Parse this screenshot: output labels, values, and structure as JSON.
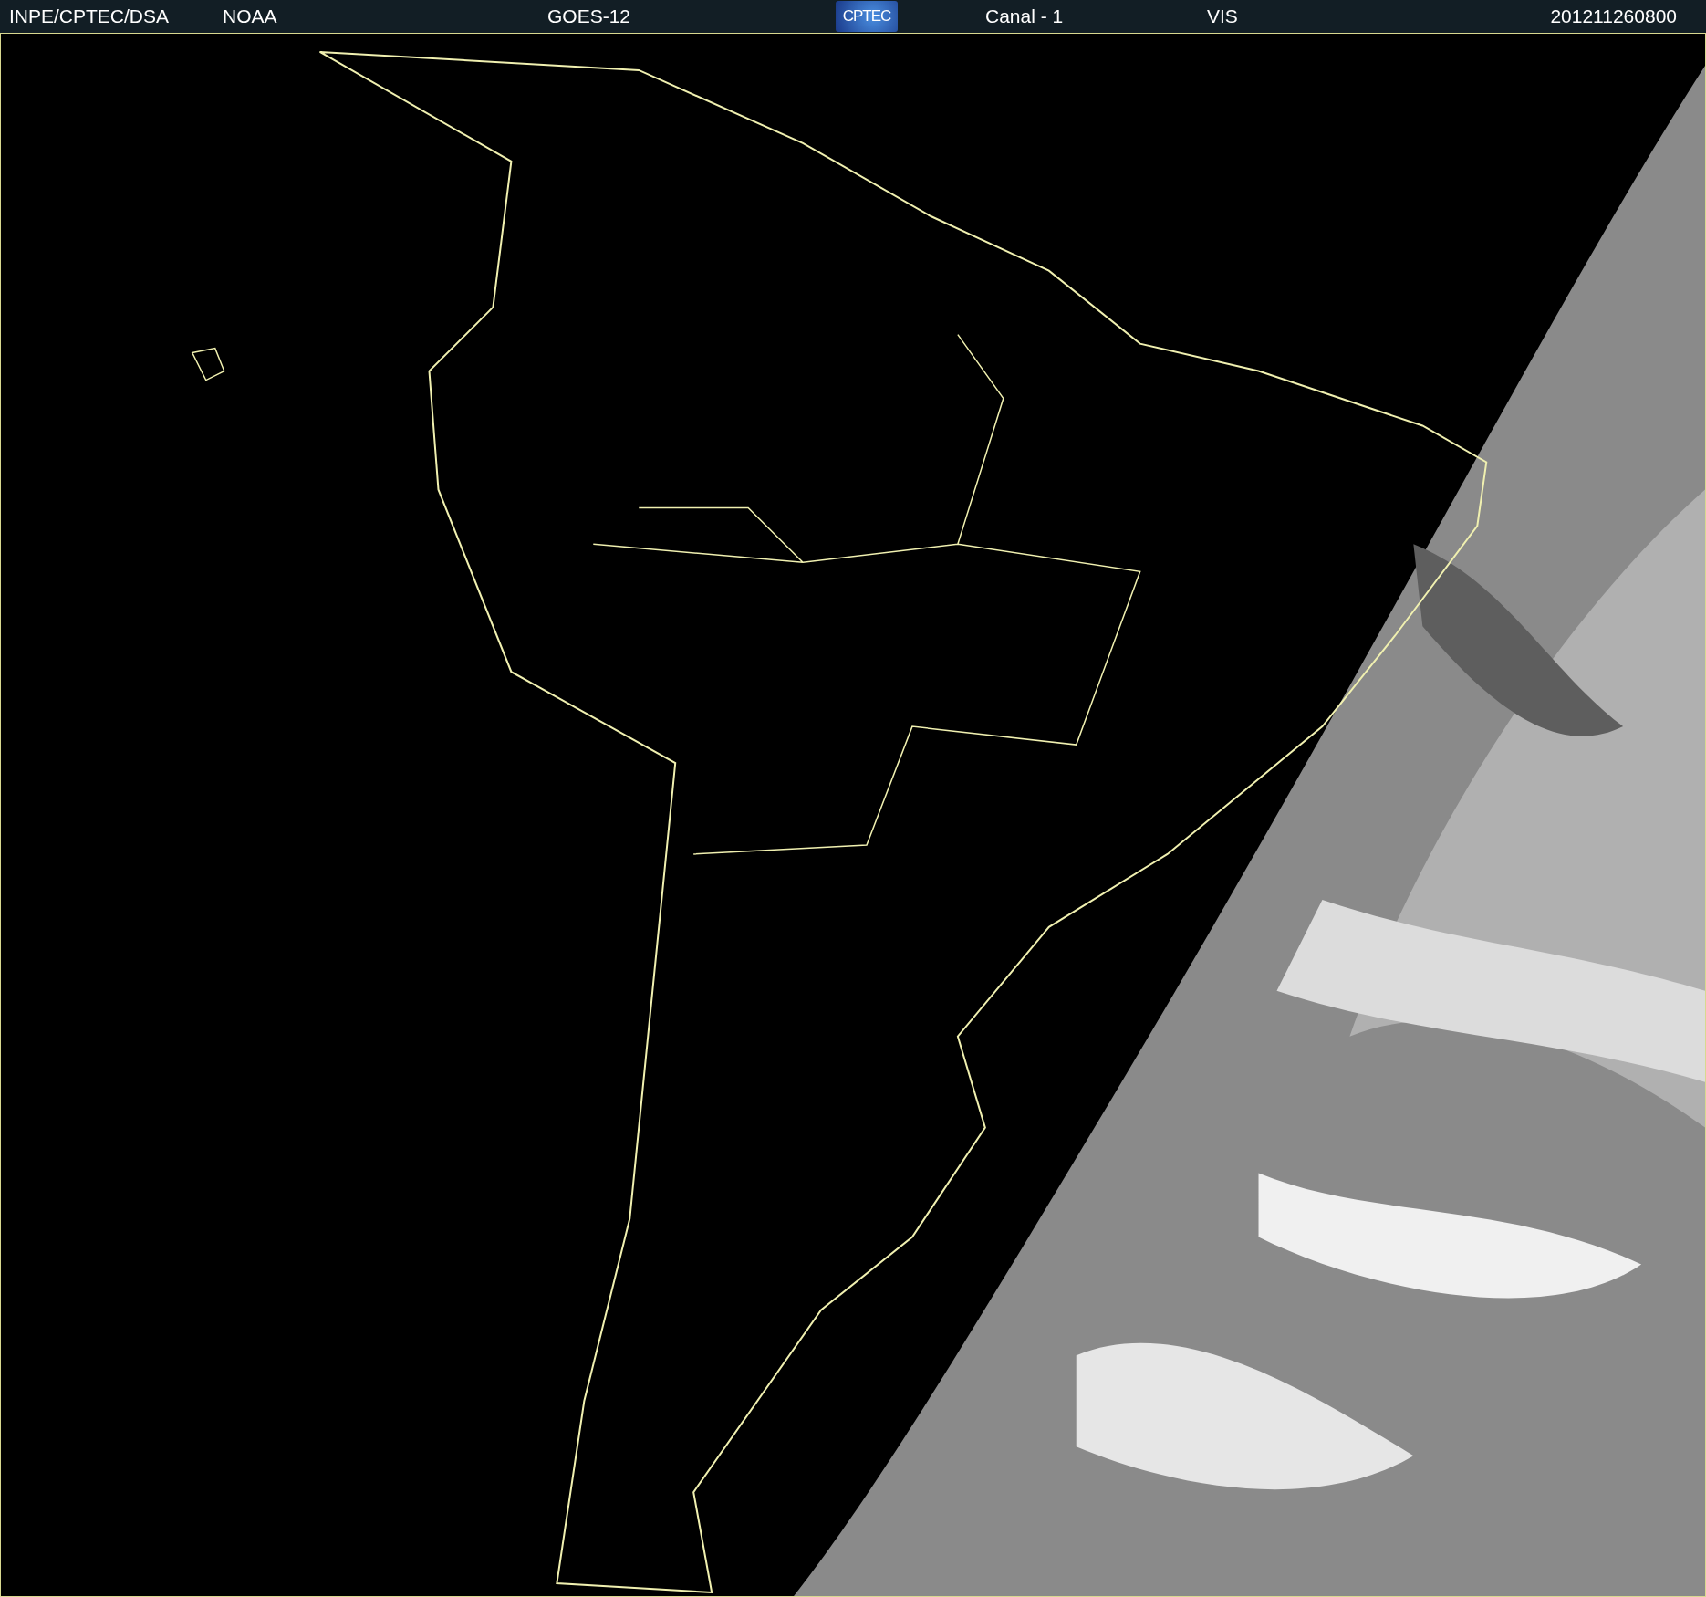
{
  "header": {
    "source": "INPE/CPTEC/DSA",
    "agency": "NOAA",
    "satellite": "GOES-12",
    "logo": "CPTEC",
    "channel": "Canal - 1",
    "band": "VIS",
    "timestamp": "201211260800"
  }
}
